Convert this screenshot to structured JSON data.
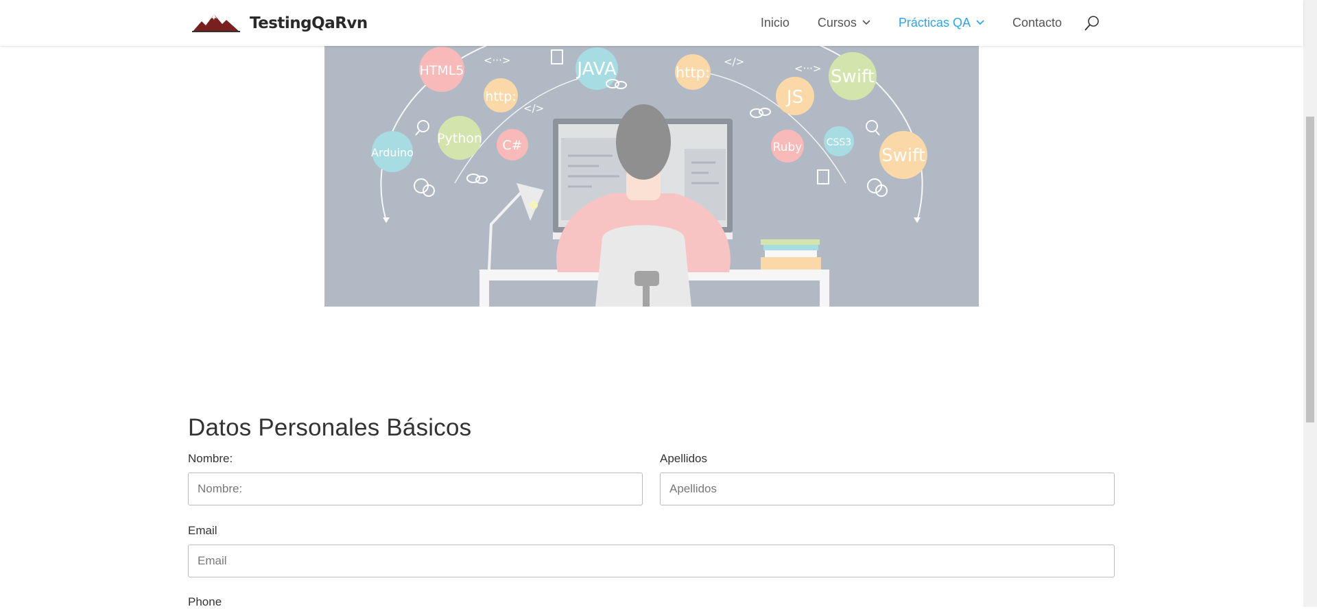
{
  "header": {
    "logo_text": "TestingQaRvn",
    "nav": [
      {
        "label": "Inicio",
        "dropdown": false,
        "active": false
      },
      {
        "label": "Cursos",
        "dropdown": true,
        "active": false
      },
      {
        "label": "Prácticas QA",
        "dropdown": true,
        "active": true
      },
      {
        "label": "Contacto",
        "dropdown": false,
        "active": false
      }
    ],
    "accent_color": "#2ea3f2"
  },
  "hero": {
    "bubbles": [
      "HTML5",
      "JAVA",
      "http:",
      "Swift",
      "http:",
      "JS",
      "Arduino",
      "Python",
      "C#",
      "Ruby",
      "CSS3",
      "Swift"
    ],
    "code_symbols": [
      "<···>",
      "</>",
      "</>",
      "<···>"
    ]
  },
  "form": {
    "title": "Datos Personales Básicos",
    "nombre_label": "Nombre:",
    "nombre_placeholder": "Nombre:",
    "apellidos_label": "Apellidos",
    "apellidos_placeholder": "Apellidos",
    "email_label": "Email",
    "email_placeholder": "Email",
    "phone_label": "Phone"
  }
}
